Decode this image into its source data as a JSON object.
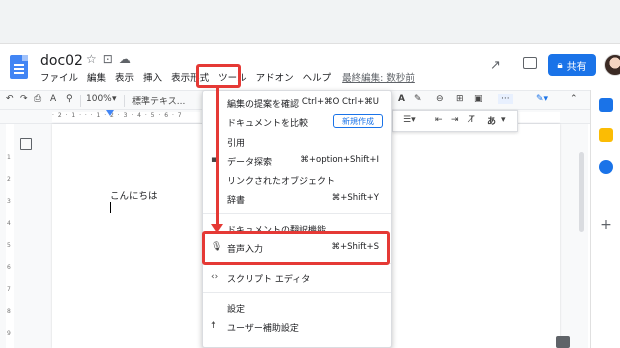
{
  "doc": {
    "title": "doc02"
  },
  "menubar": {
    "file": "ファイル",
    "edit": "編集",
    "view": "表示",
    "insert": "挿入",
    "format": "表示形式",
    "tools": "ツール",
    "addons": "アドオン",
    "help": "ヘルプ",
    "last_edit": "最終編集: 数秒前"
  },
  "header": {
    "share_label": "共有"
  },
  "toolbar": {
    "zoom": "100%",
    "style": "標準テキス..."
  },
  "page": {
    "body_text": "こんにちは"
  },
  "dropdown": {
    "items": [
      {
        "label": "編集の提案を確認",
        "shortcut": "Ctrl+⌘O Ctrl+⌘U"
      },
      {
        "label": "ドキュメントを比較",
        "badge": "新規作成"
      },
      {
        "label": "引用"
      },
      {
        "label": "データ探索",
        "shortcut": "⌘+option+Shift+I"
      },
      {
        "label": "リンクされたオブジェクト"
      },
      {
        "label": "辞書",
        "shortcut": "⌘+Shift+Y"
      },
      {
        "label": "ドキュメントの翻訳機能"
      },
      {
        "label": "音声入力",
        "shortcut": "⌘+Shift+S"
      },
      {
        "label": "スクリプト エディタ"
      },
      {
        "label": "設定"
      },
      {
        "label": "ユーザー補助設定"
      }
    ]
  },
  "format_strip": {
    "ime_label": "あ"
  },
  "colors": {
    "accent": "#1a73e8",
    "highlight": "#e53935"
  }
}
